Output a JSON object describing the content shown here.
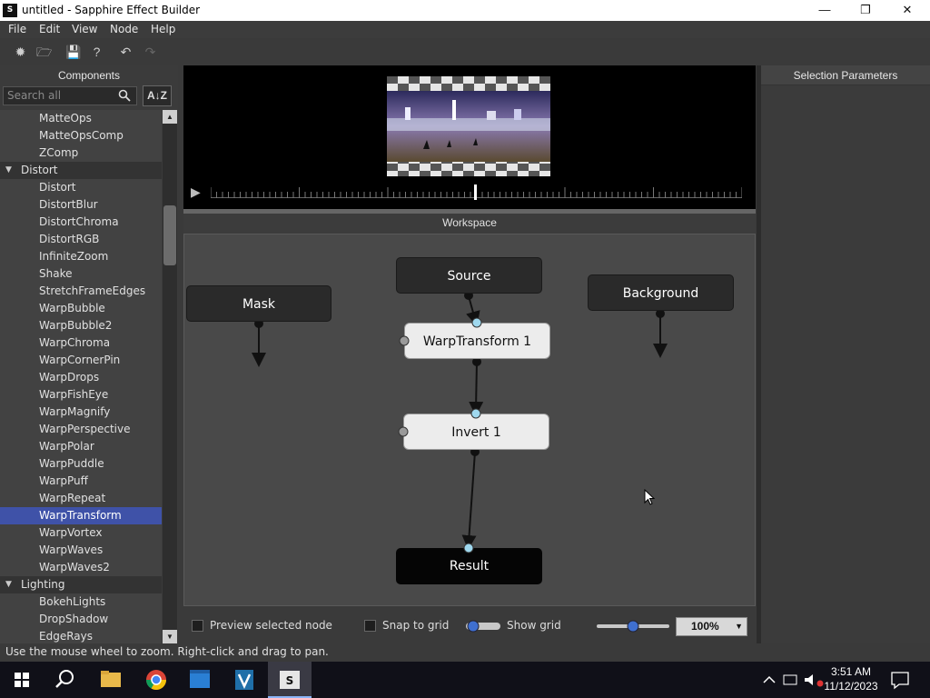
{
  "window": {
    "title": "untitled - Sapphire Effect Builder",
    "app_icon": "S"
  },
  "menubar": {
    "items": [
      "File",
      "Edit",
      "View",
      "Node",
      "Help"
    ]
  },
  "components": {
    "header": "Components",
    "search_placeholder": "Search all",
    "sort_label": "A↓Z",
    "items": [
      {
        "label": "MatteOps",
        "type": "item"
      },
      {
        "label": "MatteOpsComp",
        "type": "item"
      },
      {
        "label": "ZComp",
        "type": "item"
      },
      {
        "label": "Distort",
        "type": "category"
      },
      {
        "label": "Distort",
        "type": "item"
      },
      {
        "label": "DistortBlur",
        "type": "item"
      },
      {
        "label": "DistortChroma",
        "type": "item"
      },
      {
        "label": "DistortRGB",
        "type": "item"
      },
      {
        "label": "InfiniteZoom",
        "type": "item"
      },
      {
        "label": "Shake",
        "type": "item"
      },
      {
        "label": "StretchFrameEdges",
        "type": "item"
      },
      {
        "label": "WarpBubble",
        "type": "item"
      },
      {
        "label": "WarpBubble2",
        "type": "item"
      },
      {
        "label": "WarpChroma",
        "type": "item"
      },
      {
        "label": "WarpCornerPin",
        "type": "item"
      },
      {
        "label": "WarpDrops",
        "type": "item"
      },
      {
        "label": "WarpFishEye",
        "type": "item"
      },
      {
        "label": "WarpMagnify",
        "type": "item"
      },
      {
        "label": "WarpPerspective",
        "type": "item"
      },
      {
        "label": "WarpPolar",
        "type": "item"
      },
      {
        "label": "WarpPuddle",
        "type": "item"
      },
      {
        "label": "WarpPuff",
        "type": "item"
      },
      {
        "label": "WarpRepeat",
        "type": "item"
      },
      {
        "label": "WarpTransform",
        "type": "item",
        "selected": true
      },
      {
        "label": "WarpVortex",
        "type": "item"
      },
      {
        "label": "WarpWaves",
        "type": "item"
      },
      {
        "label": "WarpWaves2",
        "type": "item"
      },
      {
        "label": "Lighting",
        "type": "category"
      },
      {
        "label": "BokehLights",
        "type": "item"
      },
      {
        "label": "DropShadow",
        "type": "item"
      },
      {
        "label": "EdgeRays",
        "type": "item"
      }
    ]
  },
  "workspace": {
    "header": "Workspace",
    "nodes": {
      "mask": "Mask",
      "source": "Source",
      "background": "Background",
      "warp": "WarpTransform 1",
      "invert": "Invert 1",
      "result": "Result"
    },
    "preview_selected_label": "Preview selected node",
    "snap_label": "Snap to grid",
    "show_grid_label": "Show grid",
    "zoom": "100%"
  },
  "right_panel": {
    "header": "Selection Parameters"
  },
  "status": {
    "text": "Use the mouse wheel to zoom.  Right-click and drag to pan."
  },
  "taskbar": {
    "time": "3:51 AM",
    "date": "11/12/2023"
  },
  "colors": {
    "selection": "#3f52a8",
    "port": "#9fd8ee"
  }
}
